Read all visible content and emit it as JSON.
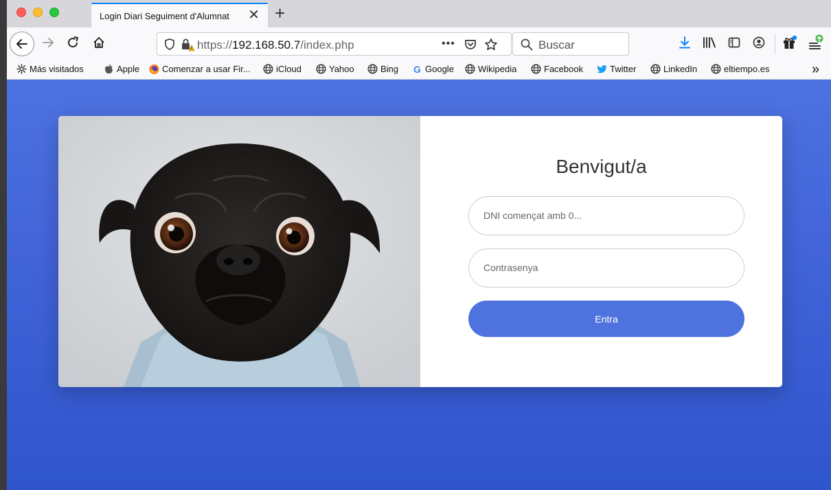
{
  "browser": {
    "tab": {
      "title": "Login Diari Seguiment d'Alumnat",
      "close_glyph": "✕"
    },
    "new_tab_glyph": "+",
    "url": {
      "scheme": "https://",
      "host": "192.168.50.7",
      "path": "/index.php"
    },
    "page_actions_glyph": "•••",
    "search": {
      "placeholder": "Buscar"
    },
    "bookmarks": [
      {
        "label": "Más visitados",
        "icon": "gear-icon"
      },
      {
        "label": "Apple",
        "icon": "apple-icon"
      },
      {
        "label": "Comenzar a usar Fir...",
        "icon": "firefox-icon"
      },
      {
        "label": "iCloud",
        "icon": "globe-icon"
      },
      {
        "label": "Yahoo",
        "icon": "globe-icon"
      },
      {
        "label": "Bing",
        "icon": "globe-icon"
      },
      {
        "label": "Google",
        "icon": "google-icon"
      },
      {
        "label": "Wikipedia",
        "icon": "globe-icon"
      },
      {
        "label": "Facebook",
        "icon": "globe-icon"
      },
      {
        "label": "Twitter",
        "icon": "twitter-icon"
      },
      {
        "label": "LinkedIn",
        "icon": "globe-icon"
      },
      {
        "label": "eltiempo.es",
        "icon": "globe-icon"
      }
    ],
    "overflow_glyph": "»"
  },
  "login": {
    "title": "Benvigut/a",
    "dni_placeholder": "DNI començat amb 0...",
    "password_placeholder": "Contrasenya",
    "submit_label": "Entra"
  },
  "colors": {
    "page_bg_top": "#4d72e0",
    "page_bg_bottom": "#2f55cc",
    "button": "#4e73df",
    "tab_accent": "#0a84ff"
  }
}
